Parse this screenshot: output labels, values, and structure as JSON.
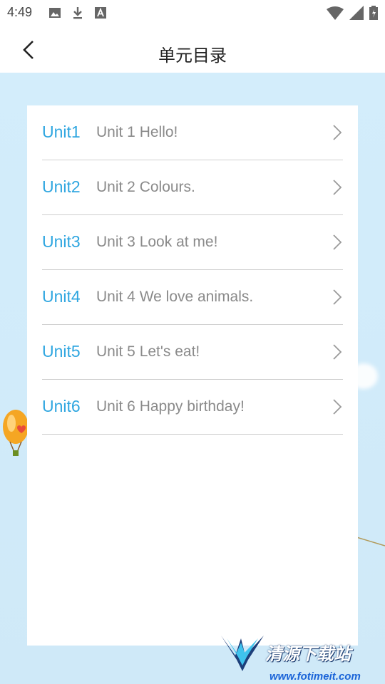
{
  "status_bar": {
    "time": "4:49",
    "left_icons": [
      "image-icon",
      "download-icon",
      "font-icon"
    ],
    "right_icons": [
      "wifi-icon",
      "signal-icon",
      "battery-icon"
    ]
  },
  "header": {
    "title": "单元目录",
    "back_icon": "chevron-left-icon"
  },
  "units": [
    {
      "code": "Unit1",
      "title": "Unit 1 Hello!"
    },
    {
      "code": "Unit2",
      "title": "Unit 2 Colours."
    },
    {
      "code": "Unit3",
      "title": "Unit 3 Look at me!"
    },
    {
      "code": "Unit4",
      "title": "Unit 4 We love animals."
    },
    {
      "code": "Unit5",
      "title": "Unit 5 Let's eat!"
    },
    {
      "code": "Unit6",
      "title": "Unit 6 Happy birthday!"
    }
  ],
  "watermark": {
    "name": "清源下载站",
    "url": "www.fotimeit.com"
  },
  "colors": {
    "accent": "#2fa6e0",
    "background": "#d6eefa",
    "subtitle": "#8a8a8a"
  }
}
